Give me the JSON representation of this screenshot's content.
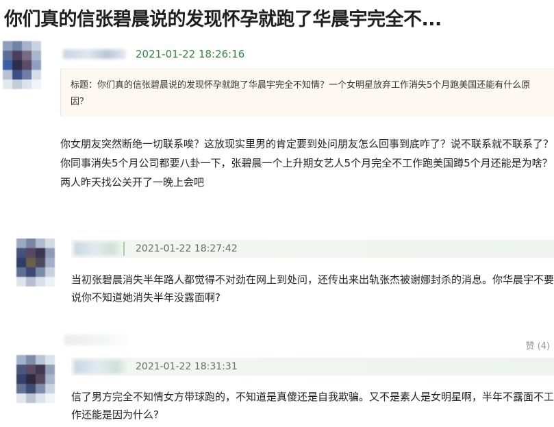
{
  "article": {
    "title": "你们真的信张碧晨说的发现怀孕就跑了华晨宇完全不..."
  },
  "main_comment": {
    "timestamp": "2021-01-22 18:26:16",
    "quote": "标题：你们真的信张碧晨说的发现怀孕就跑了华晨宇完全不知情？一个女明星放弃工作消失5个月跑美国还能有什么原因？",
    "text": "你女朋友突然断绝一切联系唉？这放现实里男的肯定要到处问朋友怎么回事到底咋了？说不联系就不联系了？你同事消失5个月公司都要八卦一下，张碧晨一个上升期女艺人5个月完全不工作跑美国蹲5个月还能是为啥？两人昨天找公关开了一晚上会吧"
  },
  "replies": [
    {
      "timestamp": "2021-01-22 18:27:42",
      "text": "当初张碧晨消失半年路人都觉得不对劲在网上到处问，还传出来出轨张杰被谢娜封杀的消息。你华晨宇不要说你不知道她消失半年没露面啊?"
    },
    {
      "timestamp": "2021-01-22 18:31:31",
      "text": "信了男方完全不知情女方带球跑的，不知道是真傻还是自我欺骗。又不是素人是女明星啊，半年不露面不工作还能是因为什么?",
      "like_label": "赞 (4)"
    }
  ],
  "colors": {
    "timestamp_green": "#2e8b3a",
    "quote_bg": "#fdf8f2",
    "reply_bar_bg": "#f3f7f3"
  }
}
